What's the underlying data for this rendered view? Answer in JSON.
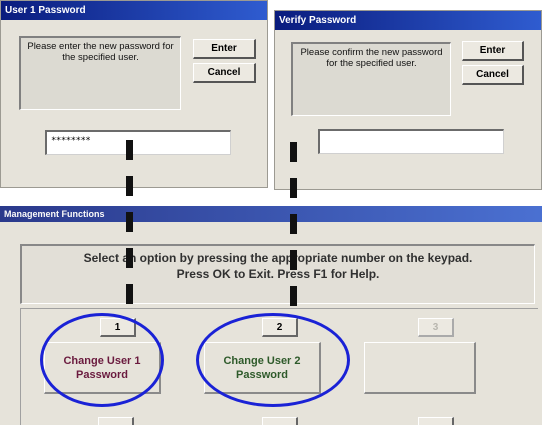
{
  "user1_dialog": {
    "title": "User 1 Password",
    "message": "Please enter the new password for the specified user.",
    "enter_label": "Enter",
    "cancel_label": "Cancel",
    "password_value": "********"
  },
  "verify_dialog": {
    "title": "Verify Password",
    "message": "Please confirm the new password for the specified user.",
    "enter_label": "Enter",
    "cancel_label": "Cancel",
    "password_value": ""
  },
  "management": {
    "title": "Management Functions",
    "instruction_line1": "Select an option by pressing the appropriate number on the keypad.",
    "instruction_line2": "Press OK to Exit. Press F1 for Help.",
    "key1_label": "1",
    "key2_label": "2",
    "key3_label": "3",
    "option1_label": "Change User 1 Password",
    "option2_label": "Change User 2 Password",
    "option1_color": "#6a1a3e",
    "option2_color": "#2e5a2a"
  },
  "annotation": {
    "ring_color": "#1a22d6",
    "dash_color": "#111111"
  }
}
